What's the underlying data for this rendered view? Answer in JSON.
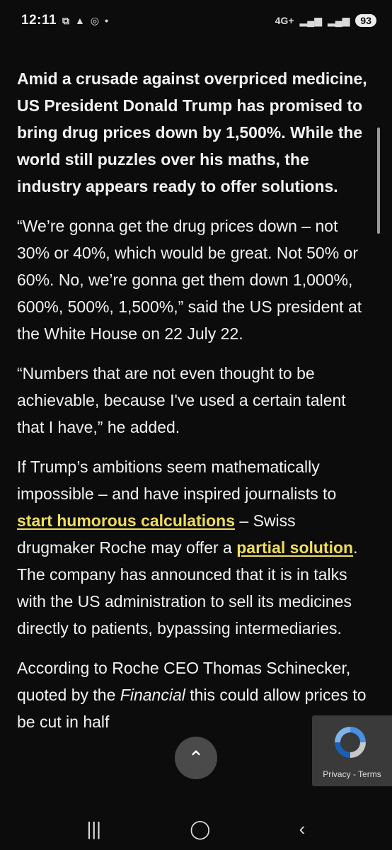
{
  "status_bar": {
    "time": "12:11",
    "left_icons": [
      "screenshot-icon",
      "warning-icon",
      "instagram-icon",
      "dot-icon"
    ],
    "network": "4G+",
    "battery": "93"
  },
  "article": {
    "lead": "Amid a crusade against overpriced medicine, US President Donald Trump has promised to bring drug prices down by 1,500%.  While the world still puzzles over his maths, the industry appears ready to offer solutions.",
    "p1": "“We’re gonna get the drug prices down – not 30% or 40%, which would be great. Not 50% or 60%. No, we’re gonna get them down 1,000%, 600%, 500%, 1,500%,” said the US president at the White House on 22 July 22.",
    "p2": "“Numbers that are not even thought to be achievable, because I've used a certain talent that I have,” he added.",
    "p3_a": "If Trump’s ambitions seem mathematically impossible – and have inspired journalists to ",
    "p3_link1": "start humorous calculations",
    "p3_b": " – Swiss drugmaker Roche may offer a ",
    "p3_link2": "partial solution",
    "p3_c": ". The company has announced that it is in talks with the US administration to sell its medicines directly to patients, bypassing intermediaries.",
    "p4_a": "According to Roche CEO Thomas Schinecker, quoted by the ",
    "p4_italic": "Financial",
    "p4_b": " this could allow prices to be cut in half"
  },
  "recaptcha": {
    "terms": "Privacy - Terms"
  },
  "colors": {
    "background": "#0c0c0c",
    "link": "#f1de58",
    "text": "#f2f2f2"
  }
}
